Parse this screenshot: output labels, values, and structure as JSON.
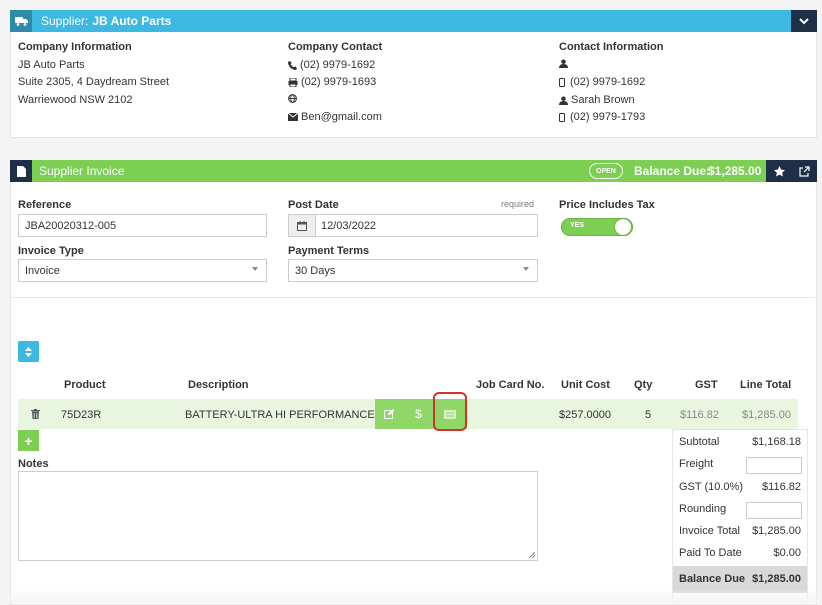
{
  "colors": {
    "supplier_header": "#3db8e0",
    "invoice_header": "#7ccf52",
    "row_highlight": "#e8f6df",
    "action_green": "#8fd868",
    "highlight_ring": "#d9302c"
  },
  "supplier": {
    "header_prefix": "Supplier:",
    "header_name": "JB Auto Parts",
    "company_info": {
      "title": "Company Information",
      "lines": [
        "JB Auto Parts",
        "Suite 2305, 4 Daydream Street",
        "Warriewood NSW 2102"
      ]
    },
    "company_contact": {
      "title": "Company Contact",
      "phone": "(02) 9979-1692",
      "fax": "(02) 9979-1693",
      "web": "",
      "email": "Ben@gmail.com"
    },
    "contact_info": {
      "title": "Contact Information",
      "person": "",
      "mobile1": "(02) 9979-1692",
      "name": "Sarah Brown",
      "mobile2": "(02) 9979-1793"
    }
  },
  "invoice": {
    "header_title": "Supplier Invoice",
    "status_badge": "OPEN",
    "balance_label": "Balance Due:",
    "balance_value": "$1,285.00",
    "reference_label": "Reference",
    "reference_value": "JBA20020312-005",
    "post_date_label": "Post Date",
    "post_date_required": "required",
    "post_date_value": "12/03/2022",
    "price_tax_label": "Price Includes Tax",
    "price_tax_toggle": "YES",
    "invoice_type_label": "Invoice Type",
    "invoice_type_value": "Invoice",
    "payment_terms_label": "Payment Terms",
    "payment_terms_value": "30 Days"
  },
  "table": {
    "headers": {
      "product": "Product",
      "description": "Description",
      "job_card": "Job Card No.",
      "unit_cost": "Unit Cost",
      "qty": "Qty",
      "gst": "GST",
      "line_total": "Line Total"
    },
    "rows": [
      {
        "product": "75D23R",
        "description": "BATTERY-ULTRA HI PERFORMANCE",
        "job_card": "",
        "unit_cost": "$257.0000",
        "qty": "5",
        "gst": "$116.82",
        "line_total": "$1,285.00"
      }
    ],
    "dollar_symbol": "$",
    "add_symbol": "+"
  },
  "notes": {
    "label": "Notes",
    "value": ""
  },
  "totals": {
    "subtotal_label": "Subtotal",
    "subtotal_value": "$1,168.18",
    "freight_label": "Freight",
    "gst_label": "GST (10.0%)",
    "gst_value": "$116.82",
    "rounding_label": "Rounding",
    "invoice_total_label": "Invoice Total",
    "invoice_total_value": "$1,285.00",
    "paid_label": "Paid To Date",
    "paid_value": "$0.00",
    "balance_label": "Balance Due",
    "balance_value": "$1,285.00"
  }
}
